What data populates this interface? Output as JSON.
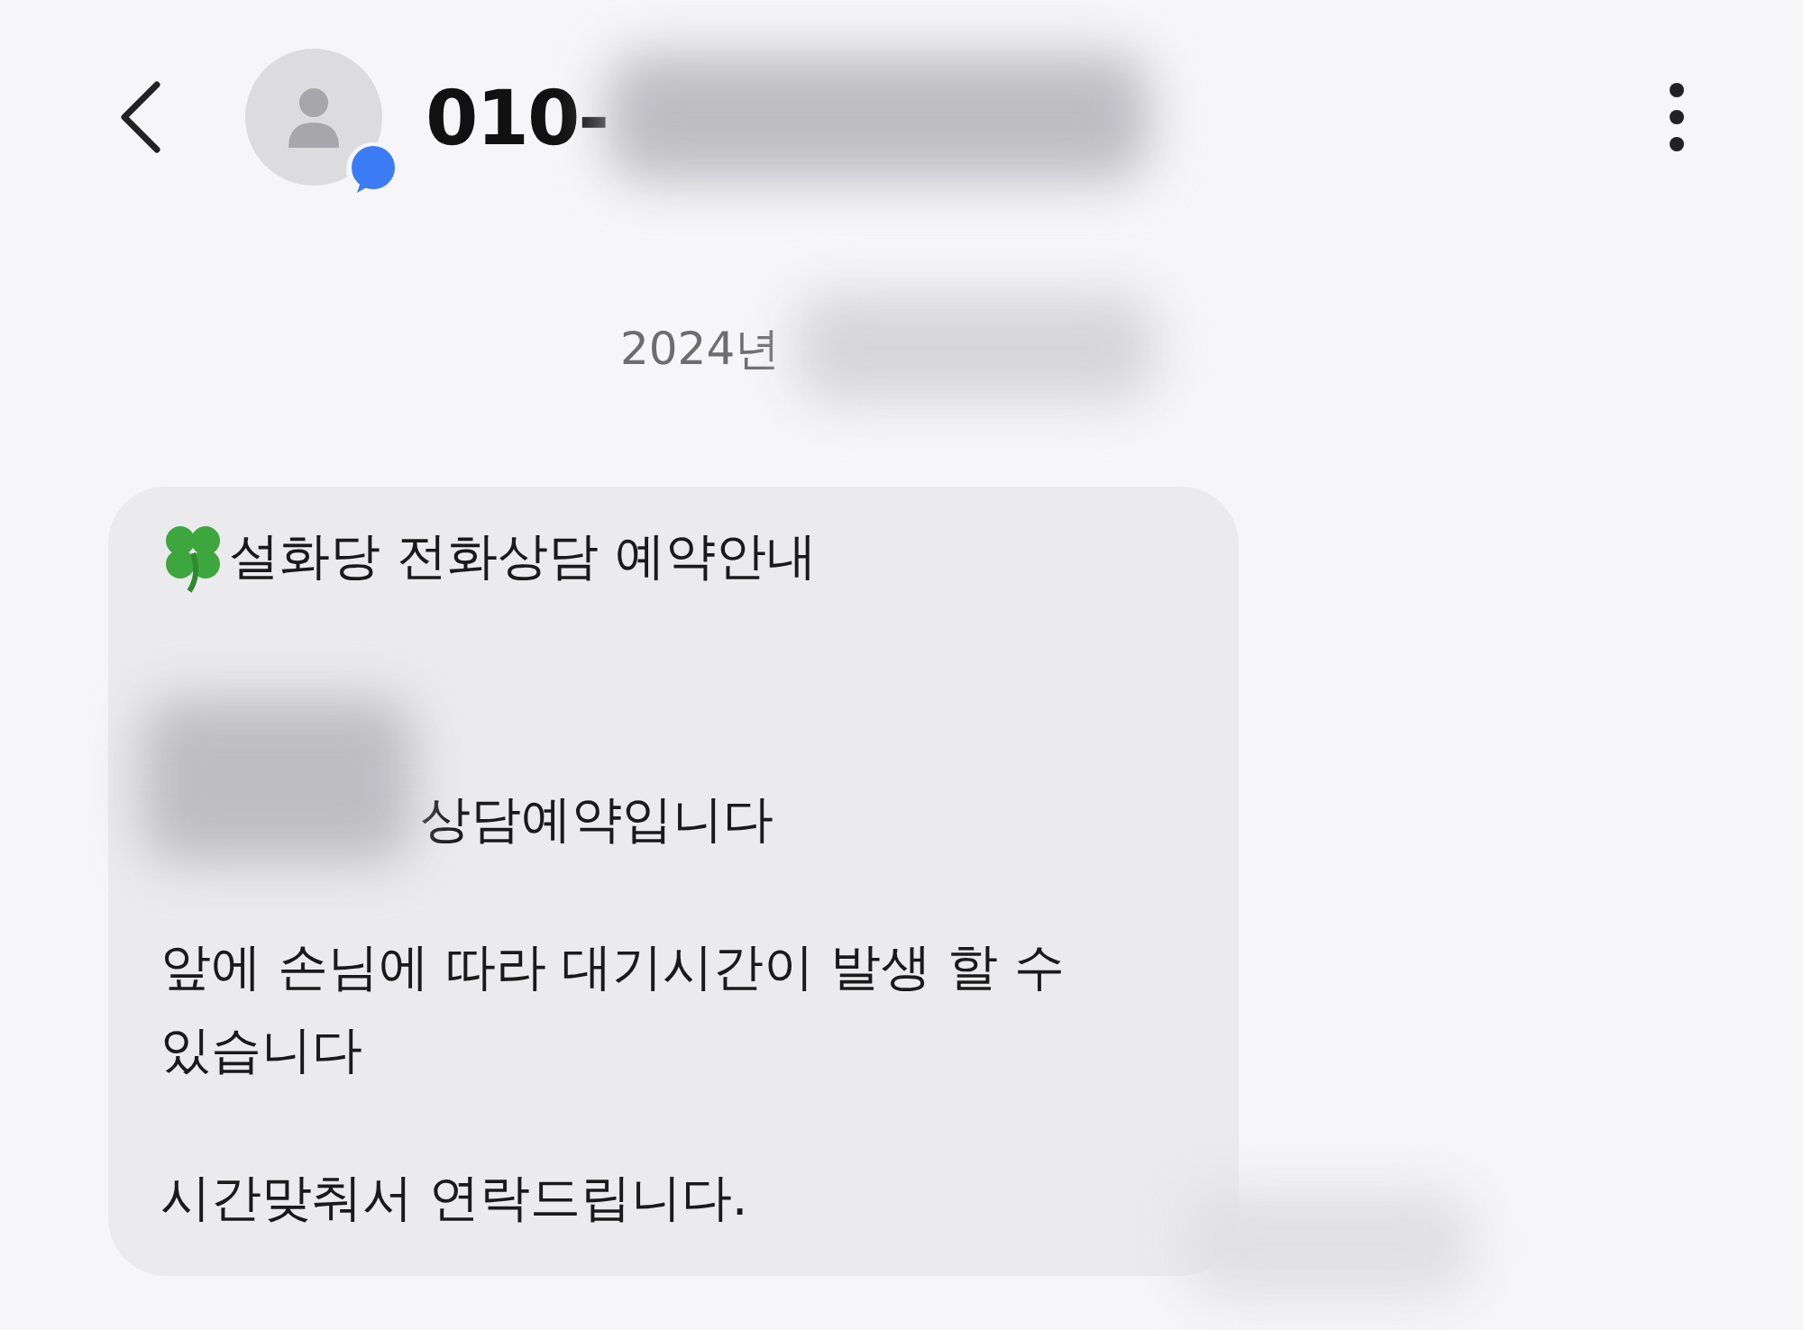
{
  "header": {
    "title": "010-",
    "has_badge": true
  },
  "date": "2024년",
  "message": {
    "title": "설화당 전화상담 예약안내",
    "paragraphs": [
      {
        "lines": [
          "상담예약입니다"
        ],
        "blurred_prefix": true
      },
      {
        "lines": [
          "앞에 손님에 따라 대기시간이 발생 할 수",
          "있습니다"
        ],
        "blurred_prefix": false
      },
      {
        "lines": [
          "시간맞춰서 연락드립니다."
        ],
        "blurred_prefix": false
      }
    ]
  }
}
